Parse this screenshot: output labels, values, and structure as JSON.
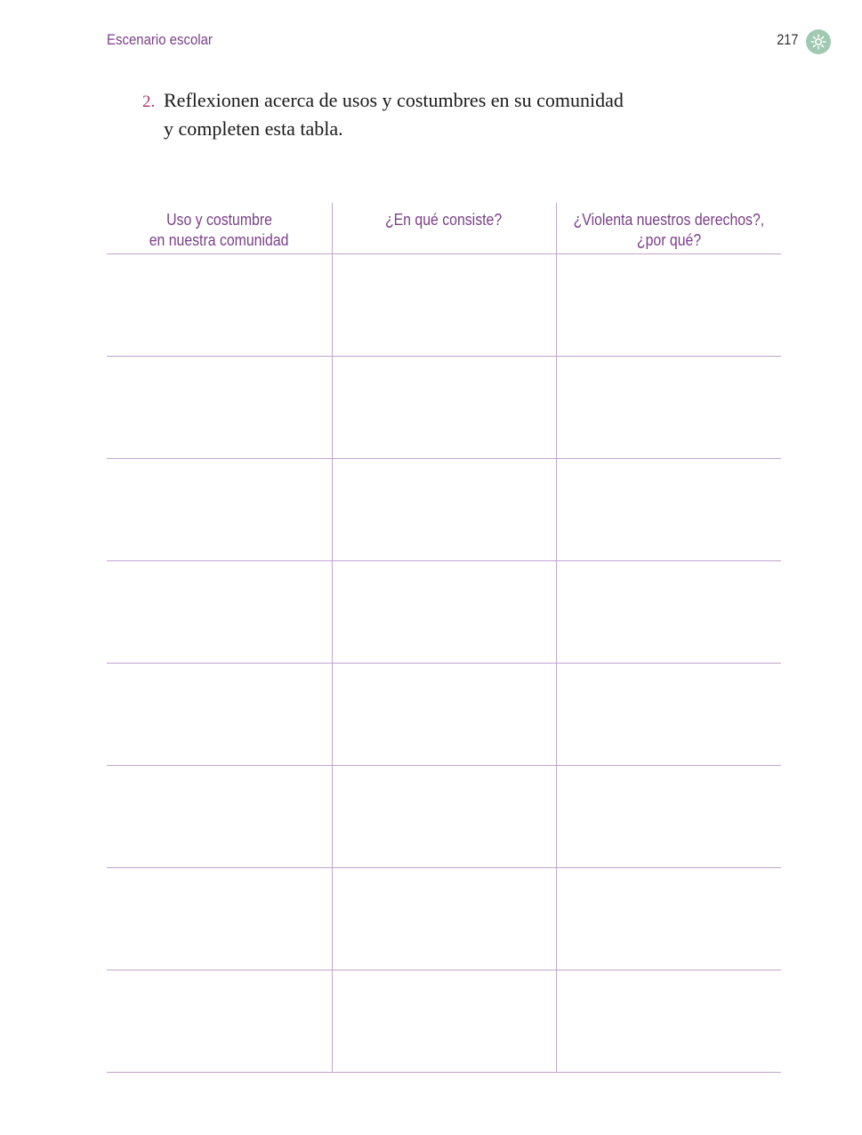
{
  "header": {
    "section_title": "Escenario escolar",
    "page_number": "217",
    "badge_icon": "sun-icon",
    "accent_color": "#7a3f88",
    "badge_color": "#9fc9b0"
  },
  "instruction": {
    "number": "2.",
    "line1": "Reflexionen acerca de usos y costumbres en su comunidad",
    "line2": "y completen esta tabla."
  },
  "table": {
    "columns": [
      {
        "line1": "Uso y costumbre",
        "line2": "en nuestra comunidad"
      },
      {
        "line1": "¿En qué consiste?",
        "line2": ""
      },
      {
        "line1": "¿Violenta nuestros derechos?,",
        "line2": "¿por qué?"
      }
    ],
    "rows": [
      [
        "",
        "",
        ""
      ],
      [
        "",
        "",
        ""
      ],
      [
        "",
        "",
        ""
      ],
      [
        "",
        "",
        ""
      ],
      [
        "",
        "",
        ""
      ],
      [
        "",
        "",
        ""
      ],
      [
        "",
        "",
        ""
      ],
      [
        "",
        "",
        ""
      ]
    ]
  }
}
